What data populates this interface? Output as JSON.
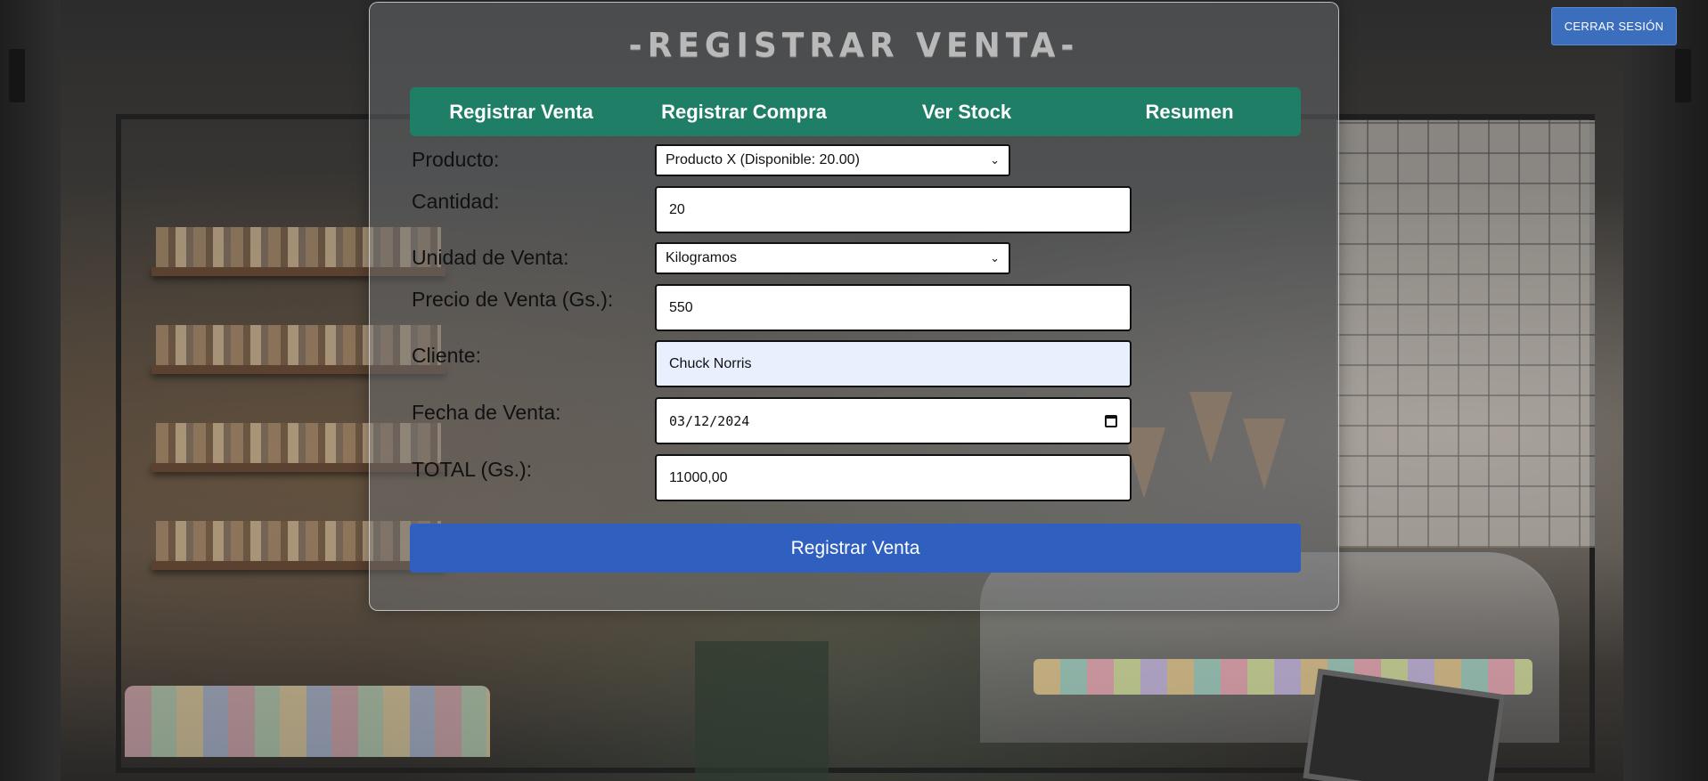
{
  "header": {
    "logout_label": "CERRAR SESIÓN"
  },
  "panel": {
    "title": "-REGISTRAR VENTA-"
  },
  "nav": {
    "items": [
      {
        "label": "Registrar Venta"
      },
      {
        "label": "Registrar Compra"
      },
      {
        "label": "Ver Stock"
      },
      {
        "label": "Resumen"
      }
    ]
  },
  "form": {
    "producto": {
      "label": "Producto:",
      "value": "Producto X (Disponible: 20.00)"
    },
    "cantidad": {
      "label": "Cantidad:",
      "value": "20"
    },
    "unidad": {
      "label": "Unidad de Venta:",
      "value": "Kilogramos"
    },
    "precio": {
      "label": "Precio de Venta (Gs.):",
      "value": "550"
    },
    "cliente": {
      "label": "Cliente:",
      "value": "Chuck Norris"
    },
    "fecha": {
      "label": "Fecha de Venta:",
      "value": "03/12/2024"
    },
    "total": {
      "label": "TOTAL (Gs.):",
      "value": "11000,00"
    },
    "submit_label": "Registrar Venta"
  },
  "colors": {
    "nav_bg": "#1f7f66",
    "submit_bg": "#2f5fbf",
    "logout_bg": "#3b6fbd",
    "autofill_bg": "#e8f0fe"
  },
  "icons": {
    "select_chevron": "chevron-down-icon",
    "date_picker": "calendar-icon"
  }
}
